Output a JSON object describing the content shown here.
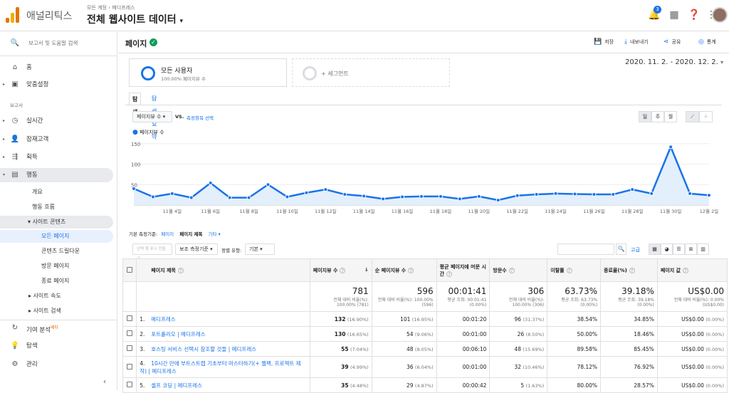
{
  "app": {
    "name": "애널리틱스",
    "crumb_account": "모든 계정",
    "crumb_property": "메디프레스",
    "view": "전체 웹사이트 데이터",
    "notif_count": "3"
  },
  "sidebar": {
    "search": "보고서 및 도움말 검색",
    "home": "홈",
    "custom": "맞춤설정",
    "reports_label": "보고서",
    "realtime": "실시간",
    "audience": "잠재고객",
    "acquisition": "획득",
    "behavior": "행동",
    "overview": "개요",
    "flow": "행동 흐름",
    "site_content": "사이트 콘텐츠",
    "all_pages": "모든 페이지",
    "drilldown": "콘텐츠 드릴다운",
    "landing": "방문 페이지",
    "exit": "종료 페이지",
    "site_speed": "사이트 속도",
    "site_search": "사이트 검색",
    "attribution": "기여 분석",
    "beta": "베타",
    "discover": "탐색",
    "admin": "관리"
  },
  "header": {
    "title": "페이지",
    "save": "저장",
    "export": "내보내기",
    "share": "공유",
    "insights": "통계",
    "daterange": "2020. 11. 2. - 2020. 12. 2."
  },
  "segments": {
    "all_users": "모든 사용자",
    "all_users_sub": "100.00% 페이지뷰 수",
    "add": "+ 세그먼트"
  },
  "tabs": {
    "explore": "탐색",
    "summary": "탐색 요약"
  },
  "chart_controls": {
    "metric": "페이지뷰 수",
    "vs": "VS.",
    "select": "측정항목 선택",
    "day": "일",
    "week": "주",
    "month": "월",
    "legend": "페이지뷰 수"
  },
  "chart_data": {
    "type": "line",
    "series": [
      {
        "name": "페이지뷰 수",
        "values": [
          40,
          20,
          28,
          18,
          54,
          18,
          18,
          50,
          20,
          30,
          38,
          26,
          22,
          15,
          20,
          21,
          21,
          15,
          21,
          12,
          23,
          26,
          28,
          27,
          26,
          26,
          38,
          28,
          142,
          28,
          24
        ]
      }
    ],
    "y_ticks": [
      "150",
      "100",
      "50"
    ],
    "x_ticks": [
      "11월 4일",
      "11월 6일",
      "11월 8일",
      "11월 10일",
      "11월 12일",
      "11월 14일",
      "11월 16일",
      "11월 18일",
      "11월 20일",
      "11월 22일",
      "11월 24일",
      "11월 26일",
      "11월 28일",
      "11월 30일",
      "12월 2일"
    ],
    "ylim": [
      0,
      160
    ],
    "color": "#1a73e8"
  },
  "dims": {
    "primary": "기본 측정기준:",
    "page": "페이지",
    "title": "페이지 제목",
    "other": "기타"
  },
  "toolbar": {
    "plot": "선택 행 표시 만들기",
    "secondary": "보조 측정기준",
    "sort": "정렬 유형:",
    "sort_val": "기본",
    "adv": "고급"
  },
  "table": {
    "headers": [
      "페이지 제목",
      "페이지뷰 수",
      "순 페이지뷰 수",
      "평균 페이지에 머문 시간",
      "방문수",
      "이탈률",
      "종료율(%)",
      "페이지 값"
    ],
    "totals": [
      {
        "v": "781",
        "s": "전체 대비 비율(%): 100.00% (781)"
      },
      {
        "v": "596",
        "s": "전체 대비 비율(%): 100.00% (596)"
      },
      {
        "v": "00:01:41",
        "s": "평균 조회: 00:01:41 (0.00%)"
      },
      {
        "v": "306",
        "s": "전체 대비 비율(%): 100.00% (306)"
      },
      {
        "v": "63.73%",
        "s": "평균 조회: 63.73% (0.00%)"
      },
      {
        "v": "39.18%",
        "s": "평균 조회: 39.18% (0.00%)"
      },
      {
        "v": "US$0.00",
        "s": "전체 대비 비율(%): 0.00% (US$0.00)"
      }
    ],
    "rows": [
      {
        "n": "1.",
        "t": "메디프레스",
        "pv": "132",
        "pvp": "(16.90%)",
        "upv": "101",
        "upvp": "(16.95%)",
        "time": "00:01:20",
        "ent": "96",
        "entp": "(31.37%)",
        "br": "38.54%",
        "ex": "34.85%",
        "val": "US$0.00",
        "valp": "(0.00%)"
      },
      {
        "n": "2.",
        "t": "포트폴리오 | 메디프레스",
        "pv": "130",
        "pvp": "(16.65%)",
        "upv": "54",
        "upvp": "(9.06%)",
        "time": "00:01:00",
        "ent": "26",
        "entp": "(8.50%)",
        "br": "50.00%",
        "ex": "18.46%",
        "val": "US$0.00",
        "valp": "(0.00%)"
      },
      {
        "n": "3.",
        "t": "호스팅 서비스 선택시 참조할 것들 | 메디프레스",
        "pv": "55",
        "pvp": "(7.04%)",
        "upv": "48",
        "upvp": "(8.05%)",
        "time": "00:06:10",
        "ent": "48",
        "entp": "(15.69%)",
        "br": "89.58%",
        "ex": "85.45%",
        "val": "US$0.00",
        "valp": "(0.00%)"
      },
      {
        "n": "4.",
        "t": "10시간 만에 부트스트랩 기초부터 마스터하기(+ 웹팩, 프로젝트 제작) | 메디프레스",
        "pv": "39",
        "pvp": "(4.99%)",
        "upv": "36",
        "upvp": "(6.04%)",
        "time": "00:01:00",
        "ent": "32",
        "entp": "(10.46%)",
        "br": "78.12%",
        "ex": "76.92%",
        "val": "US$0.00",
        "valp": "(0.00%)"
      },
      {
        "n": "5.",
        "t": "셀프 코딩 | 메디프레스",
        "pv": "35",
        "pvp": "(4.48%)",
        "upv": "29",
        "upvp": "(4.87%)",
        "time": "00:00:42",
        "ent": "5",
        "entp": "(1.63%)",
        "br": "80.00%",
        "ex": "28.57%",
        "val": "US$0.00",
        "valp": "(0.00%)"
      }
    ]
  }
}
